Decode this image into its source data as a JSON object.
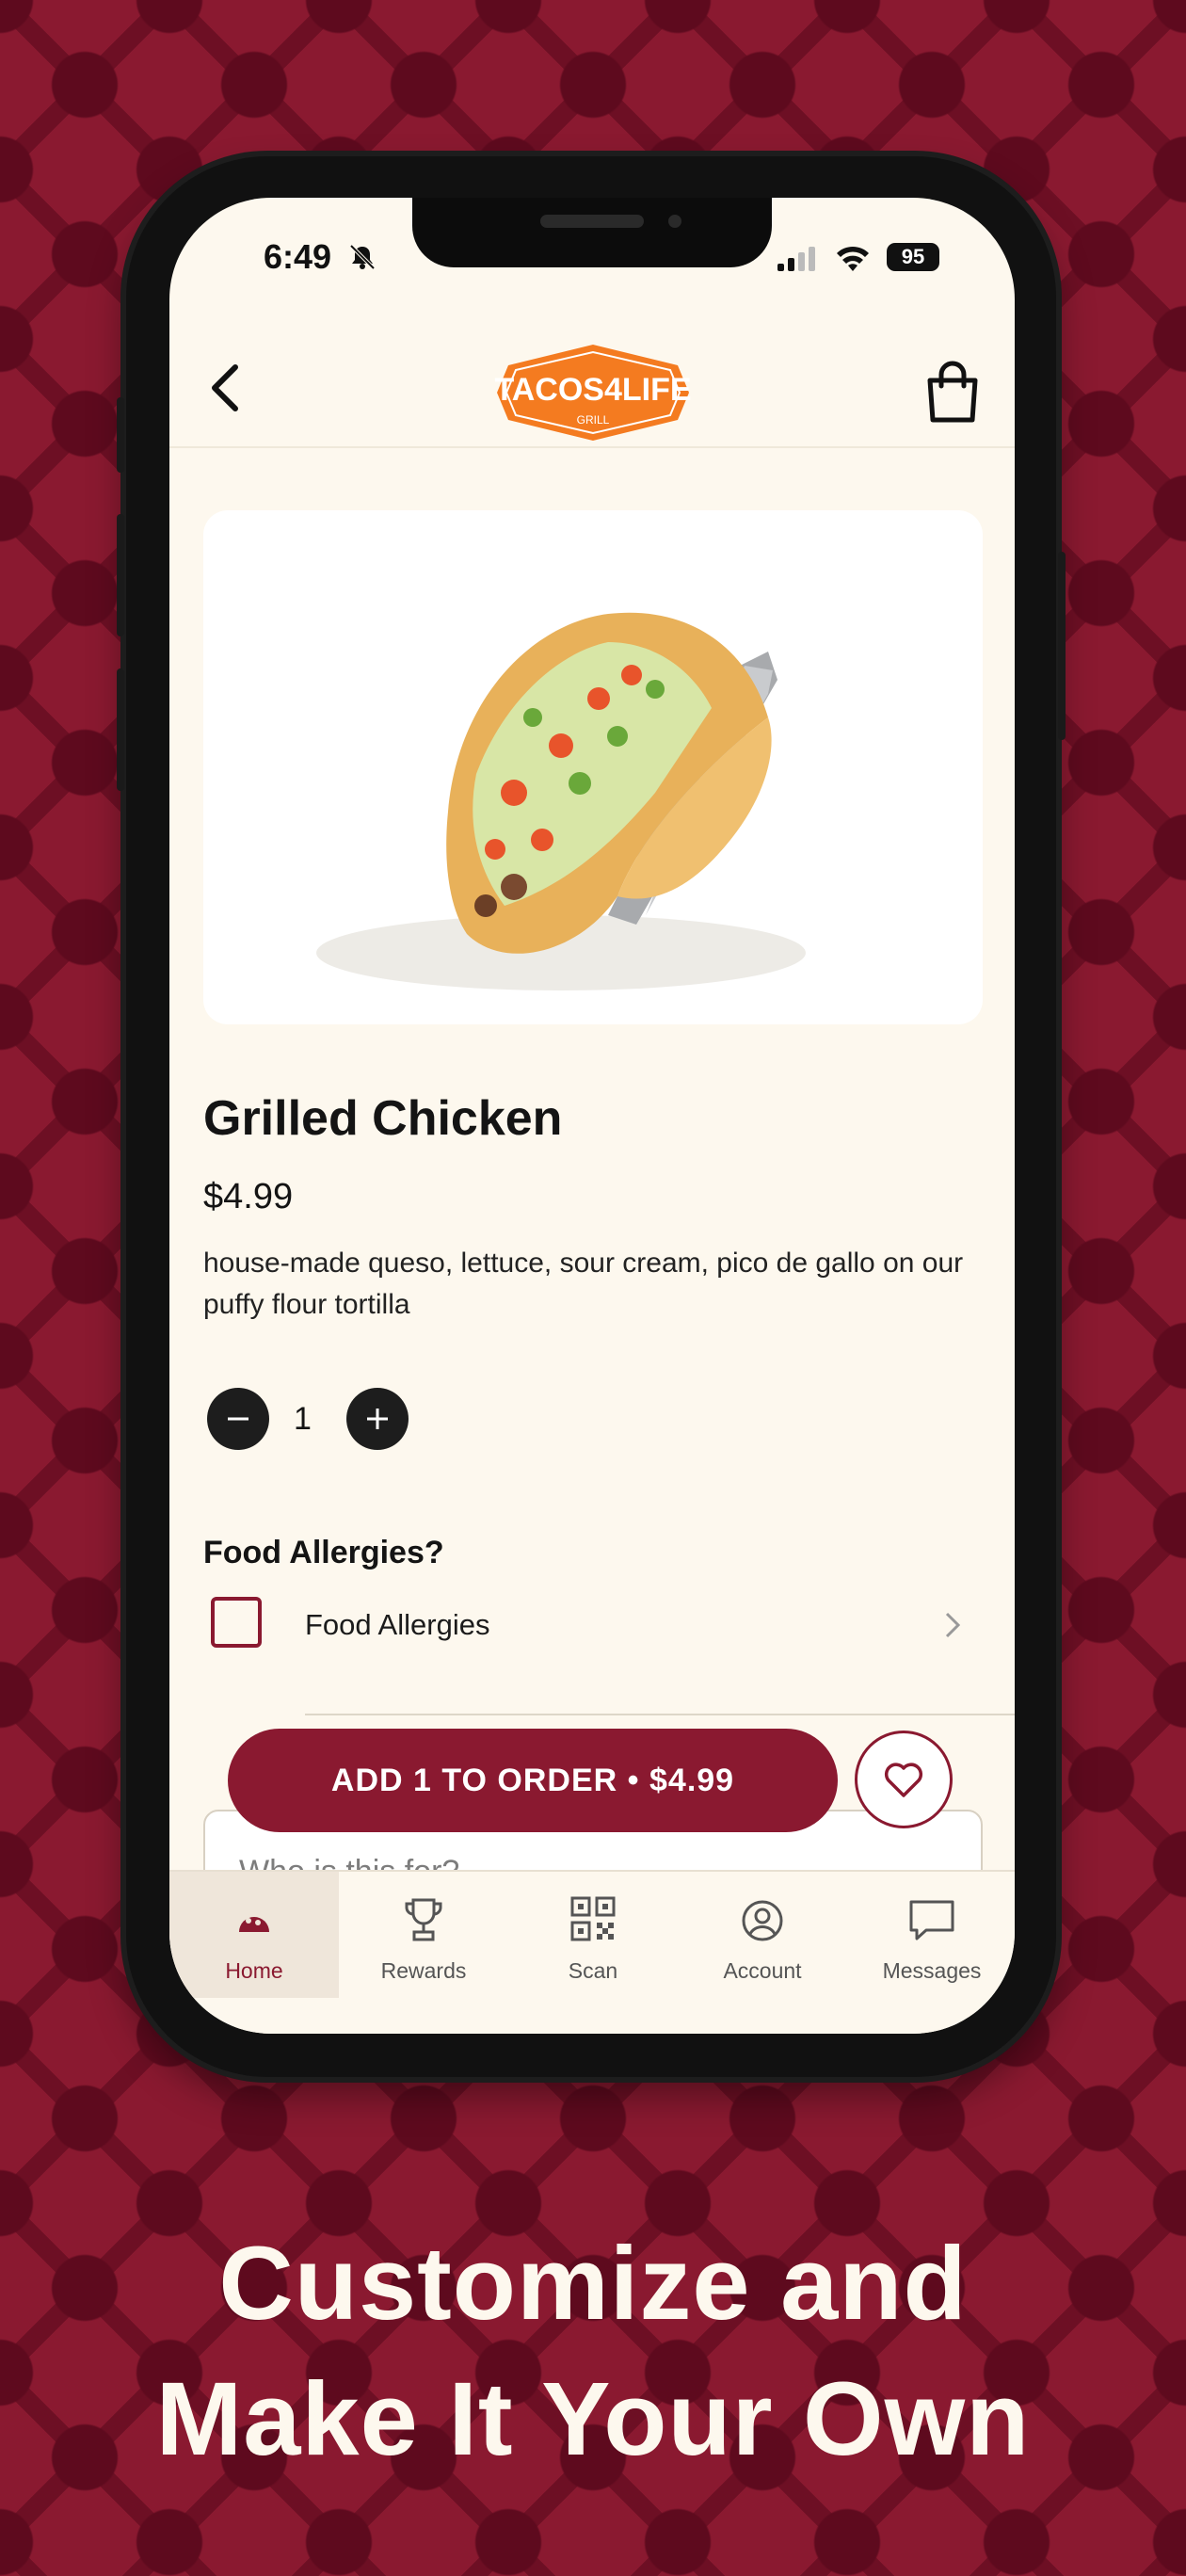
{
  "status_bar": {
    "time": "6:49",
    "battery": "95"
  },
  "header": {
    "logo_text": "TACOS4LIFE",
    "logo_sub": "GRILL"
  },
  "item": {
    "title": "Grilled Chicken",
    "price": "$4.99",
    "description": "house-made queso, lettuce, sour cream, pico de gallo on our puffy flour tortilla",
    "quantity": "1"
  },
  "allergies": {
    "heading": "Food Allergies?",
    "option_label": "Food Allergies"
  },
  "order": {
    "add_label": "ADD 1 TO ORDER • $4.99",
    "who_placeholder": "Who is this for?"
  },
  "tabs": [
    {
      "label": "Home",
      "icon": "taco-icon"
    },
    {
      "label": "Rewards",
      "icon": "trophy-icon"
    },
    {
      "label": "Scan",
      "icon": "qr-code-icon"
    },
    {
      "label": "Account",
      "icon": "account-icon"
    },
    {
      "label": "Messages",
      "icon": "message-icon"
    }
  ],
  "caption": {
    "line1": "Customize and",
    "line2": "Make It Your Own"
  },
  "colors": {
    "brand": "#8a1930",
    "background": "#fdf8ee",
    "logo_orange": "#f47b20"
  }
}
